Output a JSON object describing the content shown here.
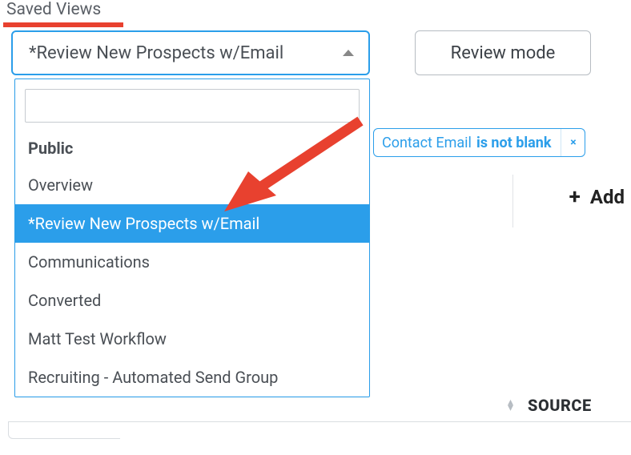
{
  "header": {
    "label": "Saved Views"
  },
  "select": {
    "value": "*Review New Prospects w/Email"
  },
  "review_button": {
    "label": "Review mode"
  },
  "filter": {
    "field": "Contact Email",
    "condition": "is not blank",
    "close": "×"
  },
  "add": {
    "label": "Add",
    "plus": "+"
  },
  "dropdown": {
    "group_label": "Public",
    "options": [
      {
        "label": "Overview"
      },
      {
        "label": "*Review New Prospects w/Email",
        "selected": true
      },
      {
        "label": "Communications"
      },
      {
        "label": "Converted"
      },
      {
        "label": "Matt Test Workflow"
      },
      {
        "label": "Recruiting - Automated Send Group"
      }
    ]
  },
  "columns": {
    "source": "SOURCE"
  }
}
